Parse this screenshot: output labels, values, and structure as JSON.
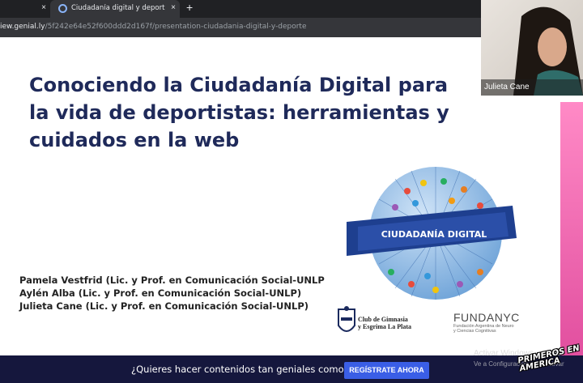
{
  "browser": {
    "tabs": [
      {
        "title": "",
        "close_icon": "×"
      },
      {
        "title": "Ciudadanía digital y deporte por",
        "close_icon": "×",
        "active": true
      }
    ],
    "new_tab_icon": "+",
    "url_prefix": "iew.genial.ly",
    "url_path": "/5f242e64e52f600ddd2d167f/presentation-ciudadania-digital-y-deporte"
  },
  "slide": {
    "title_lines": [
      "Conociendo la Ciudadanía Digital para",
      "la vida de deportistas: herramientas y",
      "cuidados en la web"
    ],
    "authors": [
      "Pamela Vestfrid (Lic. y Prof. en Comunicación Social-UNLP",
      "Aylén Alba (Lic. y Prof. en Comunicación Social-UNLP)",
      "Julieta Cane (Lic. y Prof. en Comunicación Social-UNLP)"
    ],
    "globe_banner_text": "CIUDADANÍA DIGITAL",
    "club_logo_text_1": "Club de Gimnasia",
    "club_logo_text_2": "y Esgrima La Plata",
    "fundanyc_name": "FUNDANYC",
    "fundanyc_sub_1": "Fundación Argentina de Neuro",
    "fundanyc_sub_2": "y Ciencias Cognitivas"
  },
  "webcam": {
    "name": "Julieta Cane"
  },
  "banner": {
    "text": "¿Quieres hacer contenidos tan geniales como este?",
    "button": "REGÍSTRATE AHORA"
  },
  "windows_watermark": {
    "line1": "Activar Windows",
    "line2": "Ve a Configuración para activar"
  },
  "channel_watermark": {
    "line1": "PRIMEROS EN",
    "line2": "AMERICA"
  },
  "colors": {
    "title": "#1f2a5a",
    "banner_bg": "#15173d",
    "cta": "#3a5ee6",
    "globe_ribbon": "#2b4fa8"
  }
}
